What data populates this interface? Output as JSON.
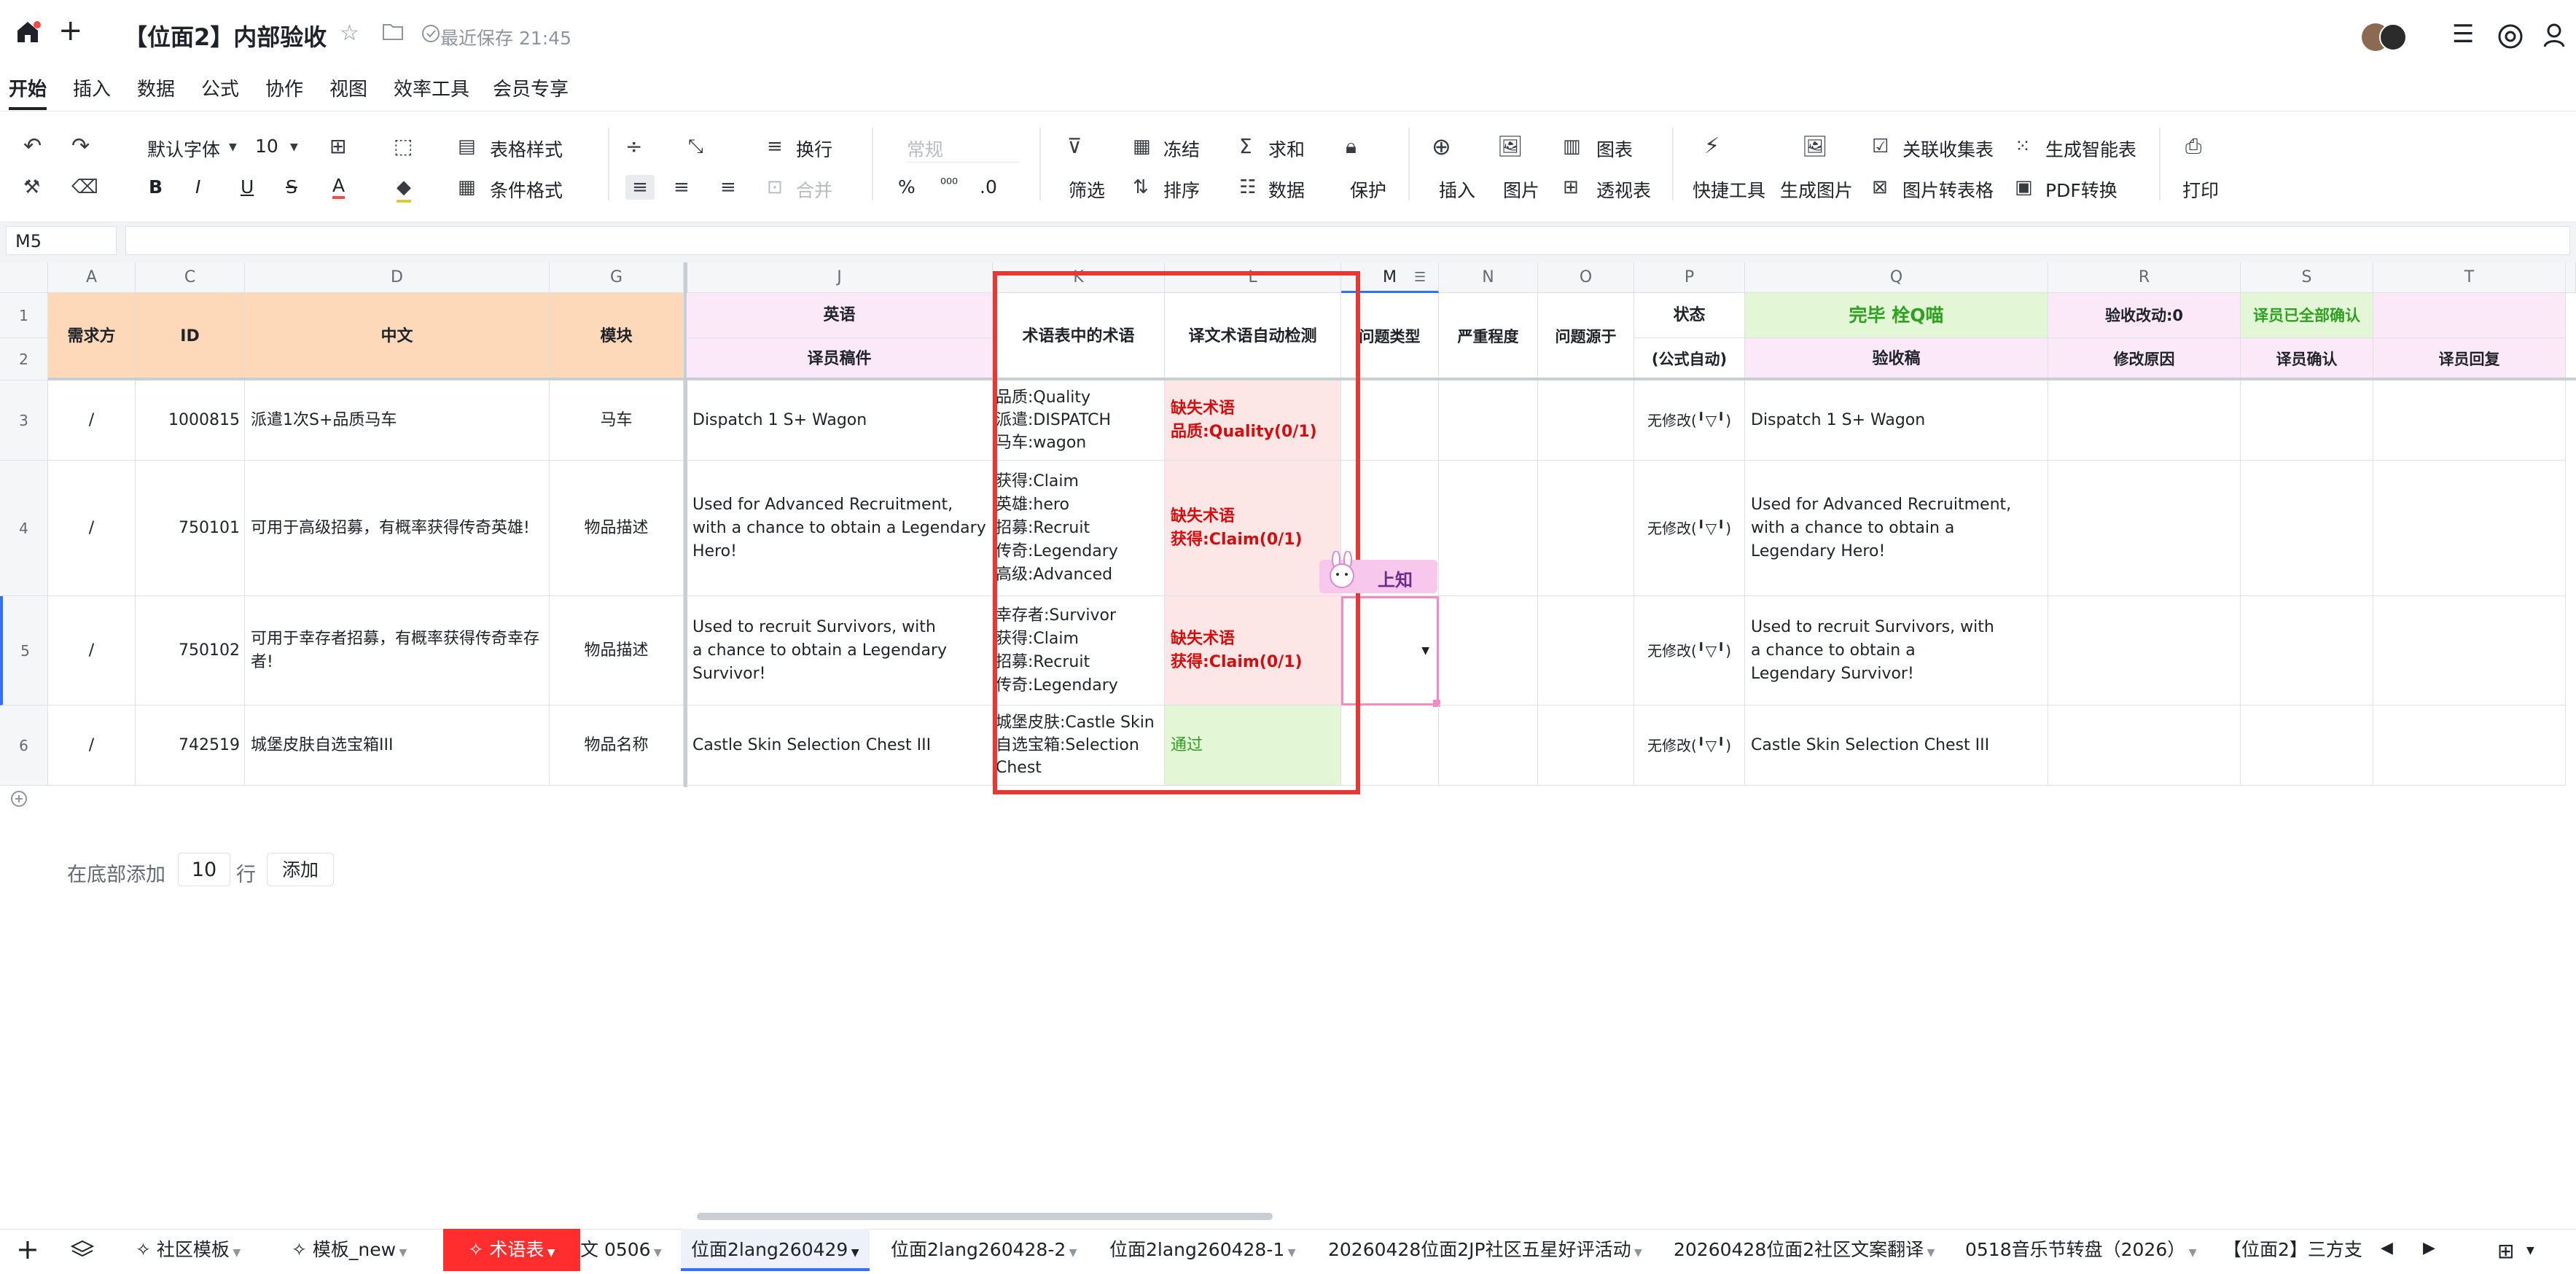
{
  "header": {
    "title": "【位面2】内部验收",
    "saved": "最近保存 21:45"
  },
  "menu": [
    "开始",
    "插入",
    "数据",
    "公式",
    "协作",
    "视图",
    "效率工具",
    "会员专享"
  ],
  "toolbar": {
    "font": "默认字体",
    "size": "10",
    "table_style": "表格样式",
    "cond_format": "条件格式",
    "wrap": "换行",
    "merge": "合并",
    "number_format": "常规",
    "decimals": ".0",
    "filter": "筛选",
    "freeze": "冻结",
    "sort": "排序",
    "sum": "求和",
    "data": "数据",
    "protect": "保护",
    "insert": "插入",
    "image": "图片",
    "chart": "图表",
    "pivot": "透视表",
    "quick_tools": "快捷工具",
    "gen_image": "生成图片",
    "linked_collection": "关联收集表",
    "image_to_table": "图片转表格",
    "smart_table": "生成智能表",
    "pdf": "PDF转换",
    "print": "打印"
  },
  "formula_bar": {
    "cell_ref": "M5",
    "value": ""
  },
  "columns": [
    "A",
    "C",
    "D",
    "G",
    "J",
    "K",
    "L",
    "M",
    "N",
    "O",
    "P",
    "Q",
    "R",
    "S",
    "T"
  ],
  "header_row1": {
    "A": "需求方",
    "C": "ID",
    "D": "中文",
    "G": "模块",
    "J": "英语",
    "K": "术语表中的术语",
    "L": "译文术语自动检测",
    "M": "问题类型",
    "N": "严重程度",
    "O": "问题源于",
    "P": "状态",
    "Q": "完毕 栓Q喵",
    "R": "验收改动:0",
    "S": "译员已全部确认",
    "T": ""
  },
  "header_row2": {
    "J": "译员稿件",
    "P": "(公式自动)",
    "Q": "验收稿",
    "R": "修改原因",
    "S": "译员确认",
    "T": "译员回复"
  },
  "rows": [
    {
      "num": "3",
      "A": "/",
      "C": "1000815",
      "D": "派遣1次S+品质马车",
      "G": "马车",
      "J": "Dispatch 1 S+ Wagon",
      "K": [
        "品质:Quality",
        "派遣:DISPATCH",
        "马车:wagon"
      ],
      "L": [
        "缺失术语",
        "品质:Quality(0/1)"
      ],
      "P": "无修改(╹▽╹)",
      "Q": "Dispatch 1 S+ Wagon"
    },
    {
      "num": "4",
      "A": "/",
      "C": "750101",
      "D": "可用于高级招募，有概率获得传奇英雄!",
      "G": "物品描述",
      "J": "Used for Advanced Recruitment, with a chance to obtain a Legendary Hero!",
      "K": [
        "获得:Claim",
        "英雄:hero",
        "招募:Recruit",
        "传奇:Legendary",
        "高级:Advanced"
      ],
      "L": [
        "缺失术语",
        "获得:Claim(0/1)"
      ],
      "P": "无修改(╹▽╹)",
      "Q": "Used for Advanced Recruitment, with a chance to obtain a Legendary Hero!"
    },
    {
      "num": "5",
      "A": "/",
      "C": "750102",
      "D": "可用于幸存者招募，有概率获得传奇幸存者!",
      "G": "物品描述",
      "J": "Used to recruit Survivors, with a chance to obtain a Legendary Survivor!",
      "K": [
        "幸存者:Survivor",
        "获得:Claim",
        "招募:Recruit",
        "传奇:Legendary"
      ],
      "L": [
        "缺失术语",
        "获得:Claim(0/1)"
      ],
      "P": "无修改(╹▽╹)",
      "Q": "Used to recruit Survivors, with a chance to obtain a Legendary Survivor!"
    },
    {
      "num": "6",
      "A": "/",
      "C": "742519",
      "D": "城堡皮肤自选宝箱III",
      "G": "物品名称",
      "J": "Castle Skin Selection Chest III",
      "K": [
        "城堡皮肤:Castle Skin",
        "自选宝箱:Selection Chest"
      ],
      "L": [
        "通过"
      ],
      "P": "无修改(╹▽╹)",
      "Q": "Castle Skin Selection Chest III"
    }
  ],
  "row_nums_header": [
    "1",
    "2"
  ],
  "tooltip": "上知",
  "add_rows": {
    "prefix": "在底部添加",
    "count": "10",
    "suffix": "行",
    "button": "添加"
  },
  "sheet_tabs": [
    "社区模板",
    "模板_new",
    "术语表",
    "文 0506",
    "位面2lang260429",
    "位面2lang260428-2",
    "位面2lang260428-1",
    "20260428位面2JP社区五星好评活动",
    "20260428位面2社区文案翻译",
    "0518音乐节转盘（2026）",
    "【位面2】三方支"
  ],
  "active_tab": "位面2lang260429",
  "colors": {
    "highlight_box": "#e53935",
    "orange_header": "#fdd9b9",
    "pink_header": "#fbe8f8",
    "green_header": "#e3f6d6",
    "red_tab": "#ff2d2d"
  }
}
